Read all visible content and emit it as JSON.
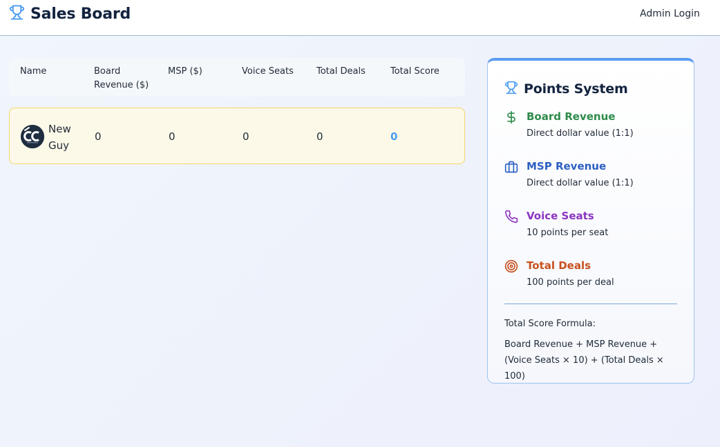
{
  "app": {
    "title": "Sales Board",
    "admin_login": "Admin Login"
  },
  "table": {
    "headers": [
      "Name",
      "Board Revenue ($)",
      "MSP ($)",
      "Voice Seats",
      "Total Deals",
      "Total Score"
    ],
    "rows": [
      {
        "name": "New Guy",
        "board_revenue": "0",
        "msp": "0",
        "voice_seats": "0",
        "total_deals": "0",
        "total_score": "0"
      }
    ]
  },
  "points_system": {
    "title": "Points System",
    "items": [
      {
        "title": "Board Revenue",
        "desc": "Direct dollar value (1:1)",
        "icon": "dollar-icon",
        "color": "#2e8b4a"
      },
      {
        "title": "MSP Revenue",
        "desc": "Direct dollar value (1:1)",
        "icon": "briefcase-icon",
        "color": "#2d5fc2"
      },
      {
        "title": "Voice Seats",
        "desc": "10 points per seat",
        "icon": "phone-icon",
        "color": "#8a35c2"
      },
      {
        "title": "Total Deals",
        "desc": "100 points per deal",
        "icon": "target-icon",
        "color": "#c7501f"
      }
    ],
    "formula_label": "Total Score Formula:",
    "formula": "Board Revenue + MSP Revenue + (Voice Seats × 10) + (Total Deals × 100)"
  },
  "colors": {
    "accent": "#5a9bf0",
    "highlight_row": "#fcf9e8",
    "score": "#4a9bf0"
  }
}
